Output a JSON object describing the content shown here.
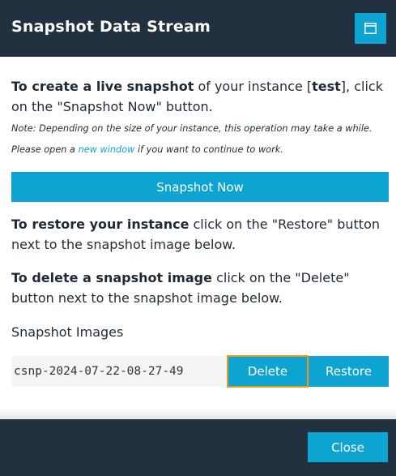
{
  "header": {
    "title": "Snapshot Data Stream",
    "window_button_icon": "window-icon"
  },
  "intro": {
    "bold_lead": "To create a live snapshot",
    "text_before_instance": " of your instance [",
    "instance_name": "test",
    "text_after_instance": "], click on the \"Snapshot Now\" button."
  },
  "note": {
    "text_before_link": "Note: Depending on the size of your instance, this operation may take a while. Please open a ",
    "link_text": "new window",
    "text_after_link": " if you want to continue to work."
  },
  "snapshot_button": {
    "label": "Snapshot Now"
  },
  "restore_info": {
    "bold_lead": "To restore your instance",
    "text": " click on the \"Restore\" button next to the snapshot image below."
  },
  "delete_info": {
    "bold_lead": "To delete a snapshot image",
    "text": " click on the \"Delete\" button next to the snapshot image below."
  },
  "images_section": {
    "heading": "Snapshot Images",
    "images": [
      {
        "name": "csnp-2024-07-22-08-27-49",
        "delete_label": "Delete",
        "restore_label": "Restore"
      }
    ]
  },
  "footer": {
    "close_label": "Close"
  },
  "colors": {
    "header_bg": "#22313f",
    "accent": "#0da4d1",
    "focus_border": "#e89a1c",
    "link": "#0da4d1"
  }
}
